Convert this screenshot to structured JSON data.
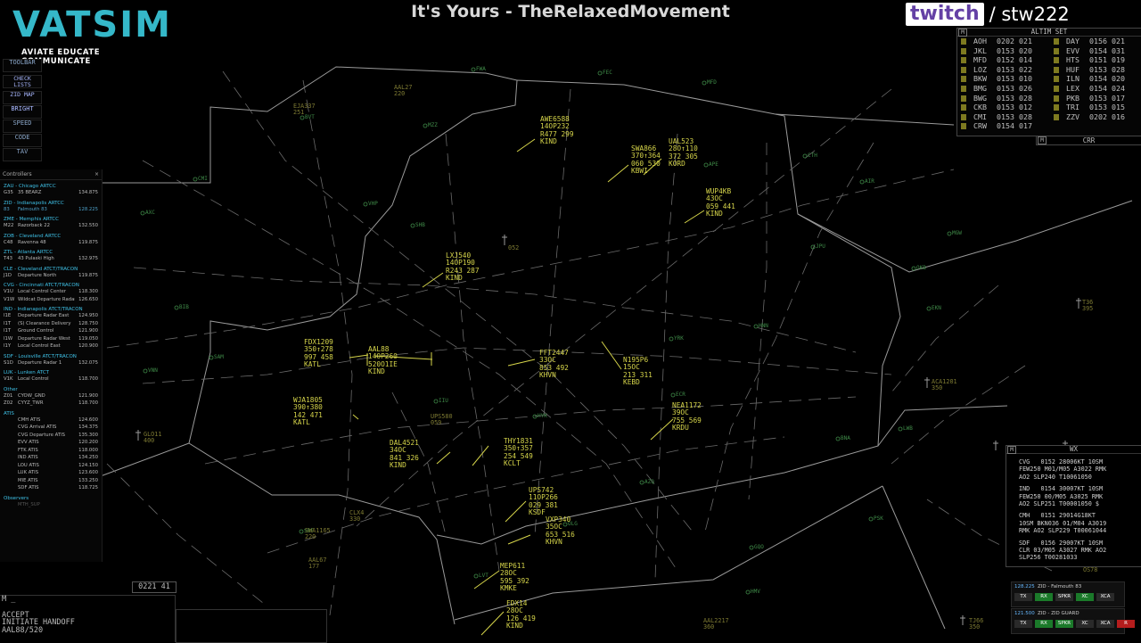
{
  "header": {
    "logo_text": "VATSIM",
    "logo_tagline": "AVIATE EDUCATE COMMUNICATE",
    "stream_title": "It's Yours - TheRelaxedMovement",
    "twitch_logo": "twitch",
    "twitch_user": "/ stw222"
  },
  "toolbar": [
    {
      "label": "TOOLBAR"
    },
    {
      "label": "CHECK LISTS"
    },
    {
      "label": "ZID MAP"
    },
    {
      "label": "BRIGHT"
    },
    {
      "label": "SPEED"
    },
    {
      "label": "CODE"
    },
    {
      "label": "TAV"
    }
  ],
  "controllers": {
    "title": "Controllers",
    "close": "×",
    "groups": [
      {
        "name": "ZAU - Chicago ARTCC",
        "rows": [
          {
            "cs": "G35",
            "name": "35 BEARZ",
            "freq": "134.875"
          }
        ]
      },
      {
        "name": "ZID - Indianapolis ARTCC",
        "rows": [
          {
            "cs": "83",
            "name": "Falmouth 83",
            "freq": "128.225",
            "hl": true
          }
        ]
      },
      {
        "name": "ZME - Memphis ARTCC",
        "rows": [
          {
            "cs": "M22",
            "name": "Razorback 22",
            "freq": "132.550"
          }
        ]
      },
      {
        "name": "ZOB - Cleveland ARTCC",
        "rows": [
          {
            "cs": "C48",
            "name": "Ravenna 48",
            "freq": "119.875"
          }
        ]
      },
      {
        "name": "ZTL - Atlanta ARTCC",
        "rows": [
          {
            "cs": "T43",
            "name": "43 Pulaski High",
            "freq": "132.975"
          }
        ]
      },
      {
        "name": "CLE - Cleveland ATCT/TRACON",
        "rows": [
          {
            "cs": "J1D",
            "name": "Departure North",
            "freq": "119.875"
          }
        ]
      },
      {
        "name": "CVG - Cincinnati ATCT/TRACON",
        "rows": [
          {
            "cs": "V1U",
            "name": "Local Control Center",
            "freq": "118.300"
          },
          {
            "cs": "V1W",
            "name": "Wildcat Departure Radar",
            "freq": "126.650"
          }
        ]
      },
      {
        "name": "IND - Indianapolis ATCT/TRACON",
        "rows": [
          {
            "cs": "I1E",
            "name": "Departure Radar East",
            "freq": "124.950"
          },
          {
            "cs": "I1T",
            "name": "(S) Clearance Delivery",
            "freq": "128.750"
          },
          {
            "cs": "I1T",
            "name": "Ground Control",
            "freq": "121.900"
          },
          {
            "cs": "I1W",
            "name": "Departure Radar West",
            "freq": "119.050"
          },
          {
            "cs": "I1Y",
            "name": "Local Control East",
            "freq": "120.900"
          }
        ]
      },
      {
        "name": "SDF - Louisville ATCT/TRACON",
        "rows": [
          {
            "cs": "S1D",
            "name": "Departure Radar 1",
            "freq": "132.075"
          }
        ]
      },
      {
        "name": "LUK - Lunken ATCT",
        "rows": [
          {
            "cs": "V1K",
            "name": "Local Control",
            "freq": "118.700"
          }
        ]
      },
      {
        "name": "Other",
        "rows": [
          {
            "cs": "Z01",
            "name": "CYOW_GND",
            "freq": "121.900"
          },
          {
            "cs": "Z02",
            "name": "CYYZ_TWR",
            "freq": "118.700"
          }
        ]
      },
      {
        "name": "ATIS",
        "rows": [
          {
            "cs": "",
            "name": "CMH ATIS",
            "freq": "124.600"
          },
          {
            "cs": "",
            "name": "CVG Arrival ATIS",
            "freq": "134.375"
          },
          {
            "cs": "",
            "name": "CVG Departure ATIS",
            "freq": "135.300"
          },
          {
            "cs": "",
            "name": "EVV ATIS",
            "freq": "120.200"
          },
          {
            "cs": "",
            "name": "FTK ATIS",
            "freq": "118.000"
          },
          {
            "cs": "",
            "name": "IND ATIS",
            "freq": "134.250"
          },
          {
            "cs": "",
            "name": "LOU ATIS",
            "freq": "124.150"
          },
          {
            "cs": "",
            "name": "LUK ATIS",
            "freq": "123.600"
          },
          {
            "cs": "",
            "name": "MIE ATIS",
            "freq": "133.250"
          },
          {
            "cs": "",
            "name": "SDF ATIS",
            "freq": "118.725"
          }
        ]
      },
      {
        "name": "Observers",
        "rows": [
          {
            "cs": "",
            "name": "MTH_SUP",
            "freq": "",
            "dim": true
          }
        ]
      }
    ]
  },
  "bottom_left": {
    "clock": "0221 41",
    "prompt": "M  _",
    "msg_lines": [
      "ACCEPT",
      "INITIATE HANDOFF",
      "AAL88/520"
    ]
  },
  "altim": {
    "m": "M",
    "title": "ALTIM SET",
    "rows": [
      [
        "AOH",
        "0202 021",
        "DAY",
        "0156 021"
      ],
      [
        "JKL",
        "0153 020",
        "EVV",
        "0154 031"
      ],
      [
        "MFD",
        "0152 014",
        "HTS",
        "0151 019"
      ],
      [
        "LOZ",
        "0153 022",
        "HUF",
        "0153 028"
      ],
      [
        "BKW",
        "0153 010",
        "ILN",
        "0154 020"
      ],
      [
        "BMG",
        "0153 026",
        "LEX",
        "0154 024"
      ],
      [
        "BWG",
        "0153 028",
        "PKB",
        "0153 017"
      ],
      [
        "CKB",
        "0153 012",
        "TRI",
        "0153 015"
      ],
      [
        "CMI",
        "0153 028",
        "ZZV",
        "0202 016"
      ],
      [
        "CRW",
        "0154 017",
        "",
        ""
      ]
    ],
    "crr_m": "M",
    "crr": "CRR"
  },
  "wx": {
    "m": "M",
    "title": "WX",
    "blocks": [
      "CVG   0152 28006KT 10SM\nFEW250 M01/M05 A3022 RMK\nAO2 SLP240 T10061050",
      "IND   0154 30007KT 10SM\nFEW250 00/M05 A3025 RMK\nAO2 SLP251 T00001050 $",
      "CMH   0151 29014G18KT\n10SM BKN036 01/M04 A3019\nRMK AO2 SLP229 T00061044",
      "SDF   0156 29007KT 10SM\nCLR 03/M05 A3027 RMK AO2\nSLP256 T00281033"
    ]
  },
  "comms": [
    {
      "freq": "128.225",
      "name": "ZID - Falmouth 83",
      "btns": [
        "TX",
        "RX",
        "SPKR",
        "XC",
        "XCA"
      ],
      "on": [
        1,
        3
      ]
    },
    {
      "freq": "121.500",
      "name": "ZID - ZID GUARD",
      "btns": [
        "TX",
        "RX",
        "SPKR",
        "XC",
        "XCA",
        "R"
      ],
      "on": [
        1,
        2
      ],
      "red": [
        5
      ]
    }
  ],
  "aircraft": [
    {
      "id": "AWE6588",
      "lines": "AWE6588\n14OP232\nR477 299\nKIND"
    },
    {
      "id": "UAL523",
      "lines": "UAL523\n28O↑110\n372 305\nKORD"
    },
    {
      "id": "SWA866",
      "lines": "SWA866\n370↑364\n060 530\nKBWI"
    },
    {
      "id": "WUP4KB",
      "lines": "WUP4KB\n43OC\n059 441\nKIND"
    },
    {
      "id": "LXJ540",
      "lines": "LXJ540\n14OP190\nR243 287\nKIND"
    },
    {
      "id": "FDX1209",
      "lines": "FDX1209\n350↑278\n997 458\nKATL"
    },
    {
      "id": "AAL88",
      "lines": "AAL88\n14OP260\n520O1IE\nKIND"
    },
    {
      "id": "FFT2447",
      "lines": "FFT2447\n33OC\n853 492\nKHVN"
    },
    {
      "id": "N195P6",
      "lines": "N195P6\n15OC\n213 311\nKEBD"
    },
    {
      "id": "WJA1805",
      "lines": "WJA1805\n390↑380\n142 471\nKATL"
    },
    {
      "id": "NEA1172",
      "lines": "NEA1172\n39OC\n755 569\nKRDU"
    },
    {
      "id": "DAL4521",
      "lines": "DAL4521\n34OC\n841 326\nKIND"
    },
    {
      "id": "THY1831",
      "lines": "THY1831\n350↑357\n254 549\nKCLT"
    },
    {
      "id": "UPS742",
      "lines": "UPS742\n11OP266\n029 381\nKSDF"
    },
    {
      "id": "VXP340",
      "lines": "VXP340\n35OC\n653 516\nKHVN"
    },
    {
      "id": "MEP611",
      "lines": "MEP611\n28OC\n595 392\nKMKE"
    },
    {
      "id": "FDX14",
      "lines": "FDX14\n28OC\n126 419\nKIND"
    }
  ],
  "ldb": [
    {
      "id": "EJA337",
      "lines": "EJA337\n251"
    },
    {
      "id": "AAL27",
      "lines": "AAL27\n220"
    },
    {
      "id": "UPS580",
      "lines": "UPS580\n059"
    },
    {
      "id": "CLX4",
      "lines": "CLX4\n330"
    },
    {
      "id": "SWA1165",
      "lines": "SWA1165\n220"
    },
    {
      "id": "AAL67",
      "lines": "AAL67\n177"
    },
    {
      "id": "GLO11",
      "lines": "GLO11\n400"
    },
    {
      "id": "T36",
      "lines": "T36\n395"
    },
    {
      "id": "ACA1201",
      "lines": "ACA1201\n350"
    },
    {
      "id": "AAL2217",
      "lines": "AAL2217\n360"
    },
    {
      "id": "TJ66",
      "lines": "TJ66\n350"
    },
    {
      "id": "OS78",
      "lines": "OS78"
    },
    {
      "id": "X52",
      "lines": "052"
    }
  ],
  "fixes": [
    "FWA",
    "FEC",
    "MFD",
    "MZZ",
    "BVT",
    "CMI",
    "VHP",
    "AXC",
    "SHB",
    "CTH",
    "AIR",
    "APE",
    "JPU",
    "MGW",
    "OKB",
    "EKN",
    "BIB",
    "HNN",
    "VNN",
    "SAM",
    "YRK",
    "ECR",
    "IIU",
    "HYK",
    "LWB",
    "AZQ",
    "PSK",
    "GQO",
    "SBE",
    "HMV",
    "LVT",
    "BNA",
    "OLG"
  ],
  "colors": {
    "datablock": "#d6d54a",
    "ldb": "#7d7a32",
    "fix": "#3f8a48",
    "vatsim": "#35b8c9",
    "twitch": "#6441a5"
  }
}
